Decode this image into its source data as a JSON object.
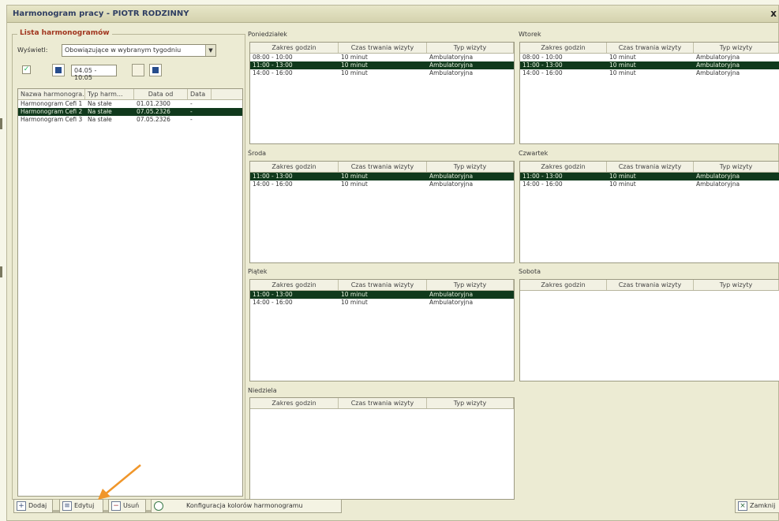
{
  "window": {
    "title": "Harmonogram pracy - PIOTR RODZINNY",
    "close_label": "x"
  },
  "list_panel": {
    "legend": "Lista harmonogramów",
    "show_label": "Wyświetl:",
    "show_select_value": "Obowiązujące w wybranym tygodniu",
    "date_range": "04.05 - 10.05",
    "columns": [
      "Nazwa harmonogra...",
      "Typ harm...",
      "Data od",
      "Data"
    ],
    "rows": [
      [
        "Harmonogram Cefi 1",
        "Na stałe",
        "01.01.2300",
        "-"
      ],
      [
        "Harmonogram Cefi 2",
        "Na stałe",
        "07.05.2326",
        "-"
      ],
      [
        "Harmonogram Cefi 3",
        "Na stałe",
        "07.05.2326",
        "-"
      ]
    ],
    "selected_row": 1
  },
  "days": {
    "columns": [
      "Zakres godzin",
      "Czas trwania wizyty",
      "Typ wizyty"
    ],
    "poniedzialek": {
      "label": "Poniedziałek",
      "rows": [
        [
          "08:00 - 10:00",
          "10 minut",
          "Ambulatoryjna"
        ],
        [
          "11:00 - 13:00",
          "10 minut",
          "Ambulatoryjna"
        ],
        [
          "14:00 - 16:00",
          "10 minut",
          "Ambulatoryjna"
        ]
      ],
      "selected_row": 1
    },
    "wtorek": {
      "label": "Wtorek",
      "rows": [
        [
          "08:00 - 10:00",
          "10 minut",
          "Ambulatoryjna"
        ],
        [
          "11:00 - 13:00",
          "10 minut",
          "Ambulatoryjna"
        ],
        [
          "14:00 - 16:00",
          "10 minut",
          "Ambulatoryjna"
        ]
      ],
      "selected_row": 1
    },
    "sroda": {
      "label": "Środa",
      "rows": [
        [
          "11:00 - 13:00",
          "10 minut",
          "Ambulatoryjna"
        ],
        [
          "14:00 - 16:00",
          "10 minut",
          "Ambulatoryjna"
        ]
      ],
      "selected_row": 0
    },
    "czwartek": {
      "label": "Czwartek",
      "rows": [
        [
          "11:00 - 13:00",
          "10 minut",
          "Ambulatoryjna"
        ],
        [
          "14:00 - 16:00",
          "10 minut",
          "Ambulatoryjna"
        ]
      ],
      "selected_row": 0
    },
    "piatek": {
      "label": "Piątek",
      "rows": [
        [
          "11:00 - 13:00",
          "10 minut",
          "Ambulatoryjna"
        ],
        [
          "14:00 - 16:00",
          "10 minut",
          "Ambulatoryjna"
        ]
      ],
      "selected_row": 0
    },
    "sobota": {
      "label": "Sobota",
      "rows": [],
      "selected_row": -1
    },
    "niedziela": {
      "label": "Niedziela",
      "rows": [],
      "selected_row": -1
    }
  },
  "toolbar": {
    "add_label": "Dodaj",
    "edit_label": "Edytuj",
    "delete_label": "Usuń",
    "colors_label": "Konfiguracja kolorów harmonogramu",
    "close_label": "Zamknij"
  },
  "colors": {
    "selection": "#10391c",
    "legend": "#a0351e",
    "title": "#2f3e62",
    "arrow": "#f0962a"
  }
}
